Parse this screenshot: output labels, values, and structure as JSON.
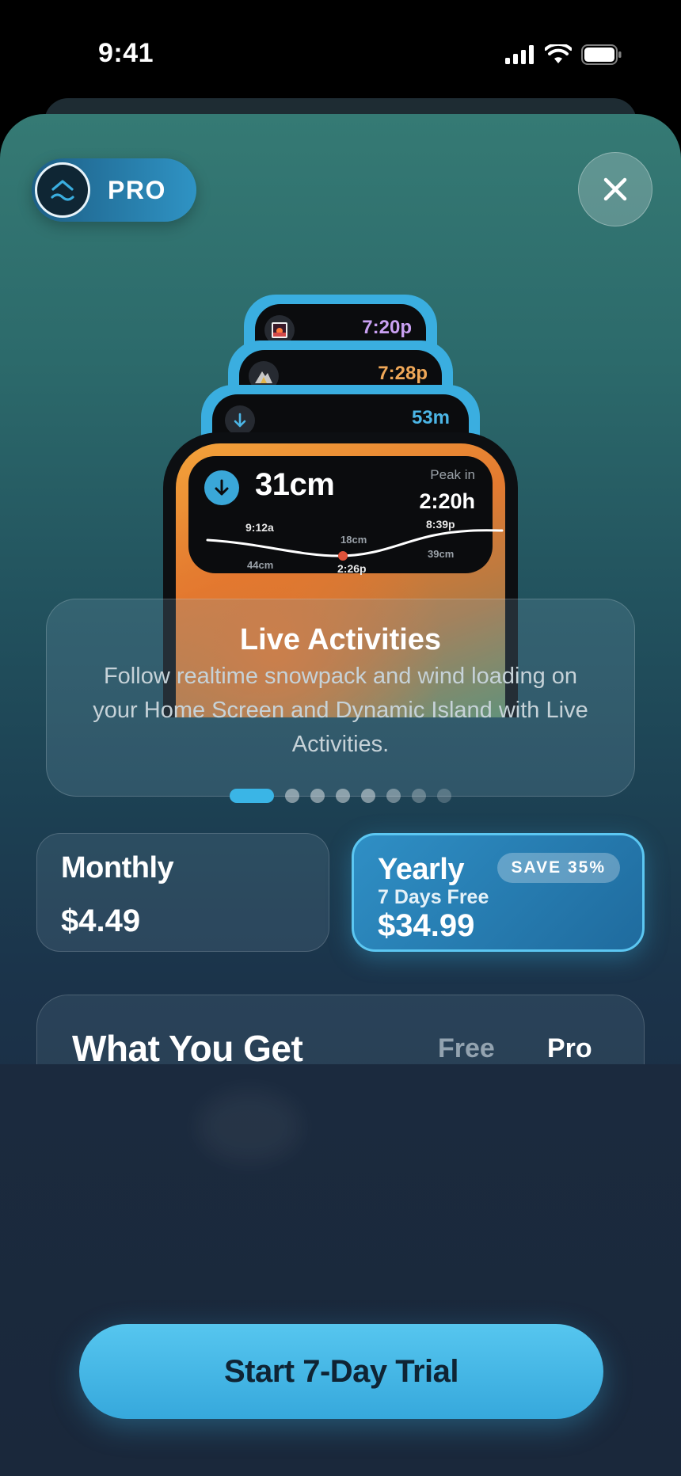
{
  "status_bar": {
    "time": "9:41"
  },
  "badge": {
    "label": "PRO"
  },
  "islands": [
    {
      "icon": "sunset-icon",
      "value": "7:20p",
      "color": "#c9a0f2"
    },
    {
      "icon": "mountain-icon",
      "value": "7:28p",
      "color": "#f0a858"
    },
    {
      "icon": "arrow-down-icon",
      "value": "53m",
      "color": "#4cb6e6"
    }
  ],
  "widget": {
    "current": "31cm",
    "peak_label": "Peak in",
    "peak_time": "2:20h",
    "low_time": "9:12a",
    "low_value": "44cm",
    "mid_value": "18cm",
    "mid_time": "2:26p",
    "high_time": "8:39p",
    "high_value": "39cm"
  },
  "feature": {
    "title": "Live Activities",
    "description": "Follow realtime snowpack and wind loading on your Home Screen and Dynamic Island with Live Activities."
  },
  "pager": {
    "count": 8,
    "active": 0
  },
  "plans": {
    "monthly": {
      "name": "Monthly",
      "price": "$4.49"
    },
    "yearly": {
      "name": "Yearly",
      "badge": "SAVE 35%",
      "trial": "7 Days Free",
      "price": "$34.99"
    }
  },
  "comparison": {
    "title": "What You Get",
    "col_free": "Free",
    "col_pro": "Pro"
  },
  "cta": {
    "label": "Start 7-Day Trial"
  },
  "colors": {
    "accent": "#3aaee0",
    "sheet_top": "#357a74",
    "sheet_bottom": "#1b2a3f"
  }
}
